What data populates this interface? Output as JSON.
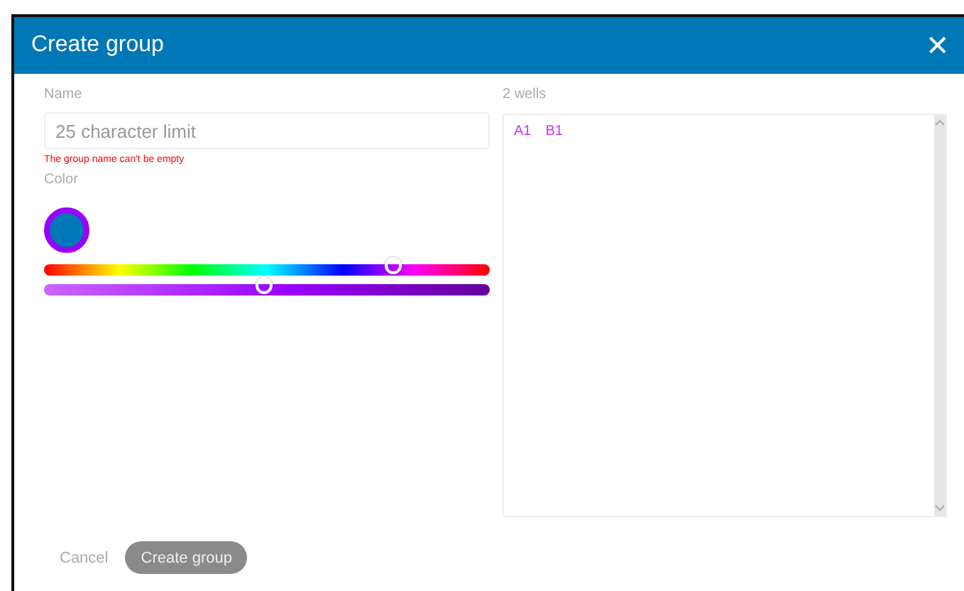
{
  "window": {
    "title": "Create group",
    "close": "✕"
  },
  "name_field": {
    "label": "Name",
    "placeholder": "25 character limit",
    "error": "The group name can't be empty"
  },
  "color": {
    "label": "Color",
    "swatch": {
      "color": "#0077b6"
    },
    "sliders": [
      {
        "kind": "hue",
        "level": 0.78
      },
      {
        "kind": "shade",
        "level": 0.49
      }
    ]
  },
  "wells": {
    "label": "2 wells",
    "items": [
      {
        "name": "A1",
        "color": "#cc33ff"
      },
      {
        "name": "B1",
        "color": "#cc33ff"
      }
    ]
  },
  "buttons": [
    {
      "label": "Cancel",
      "kind": "text",
      "disabled": true
    },
    {
      "label": "Create group",
      "kind": "primary",
      "disabled": true
    }
  ]
}
